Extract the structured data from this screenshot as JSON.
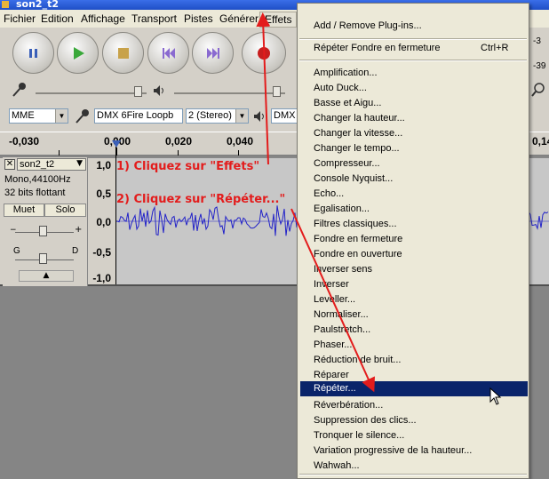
{
  "window": {
    "title": "son2_t2"
  },
  "menubar": {
    "items": [
      "Fichier",
      "Edition",
      "Affichage",
      "Transport",
      "Pistes",
      "Générer",
      "Effets"
    ]
  },
  "toolbar": {
    "buttons": [
      "pause-icon",
      "play-icon",
      "stop-icon",
      "skip-start-icon",
      "skip-end-icon",
      "record-icon"
    ],
    "host": "MME",
    "output_device": "DMX 6Fire Loopb",
    "channels": "2 (Stereo)",
    "input_device": "DMX (",
    "meter_labels": [
      "-3",
      "-39"
    ]
  },
  "ruler": {
    "labels": [
      "-0,030",
      "0,000",
      "0,020",
      "0,040",
      "0,14"
    ]
  },
  "track": {
    "name": "son2_t2",
    "info_line1": "Mono,44100Hz",
    "info_line2": "32 bits flottant",
    "mute_label": "Muet",
    "solo_label": "Solo",
    "pan_left": "G",
    "pan_right": "D",
    "scale": [
      "1,0",
      "0,5",
      "0,0",
      "-0,5",
      "-1,0"
    ],
    "colors": {
      "wave": "#2323c8",
      "background": "#c7c7c7"
    }
  },
  "effects_menu": {
    "items_top": [
      {
        "label": "Add / Remove Plug-ins..."
      },
      {
        "label": "Répéter Fondre en fermeture",
        "shortcut": "Ctrl+R"
      }
    ],
    "items": [
      "Amplification...",
      "Auto Duck...",
      "Basse et Aigu...",
      "Changer la hauteur...",
      "Changer la vitesse...",
      "Changer le tempo...",
      "Compresseur...",
      "Console Nyquist...",
      "Echo...",
      "Egalisation...",
      "Filtres classiques...",
      "Fondre en fermeture",
      "Fondre en ouverture",
      "Inverser sens",
      "Inverser",
      "Leveller...",
      "Normaliser...",
      "Paulstretch...",
      "Phaser...",
      "Réduction de bruit...",
      "Réparer",
      "Répéter...",
      "Réverbération...",
      "Suppression des clics...",
      "Tronquer le silence...",
      "Variation progressive de la hauteur...",
      "Wahwah..."
    ],
    "selected_index": 21,
    "selection_color": "#0a246a"
  },
  "annotations": {
    "step1": "1) Cliquez sur \"Effets\"",
    "step2": "2) Cliquez sur \"Répéter...\"",
    "color": "#e31c1c"
  }
}
